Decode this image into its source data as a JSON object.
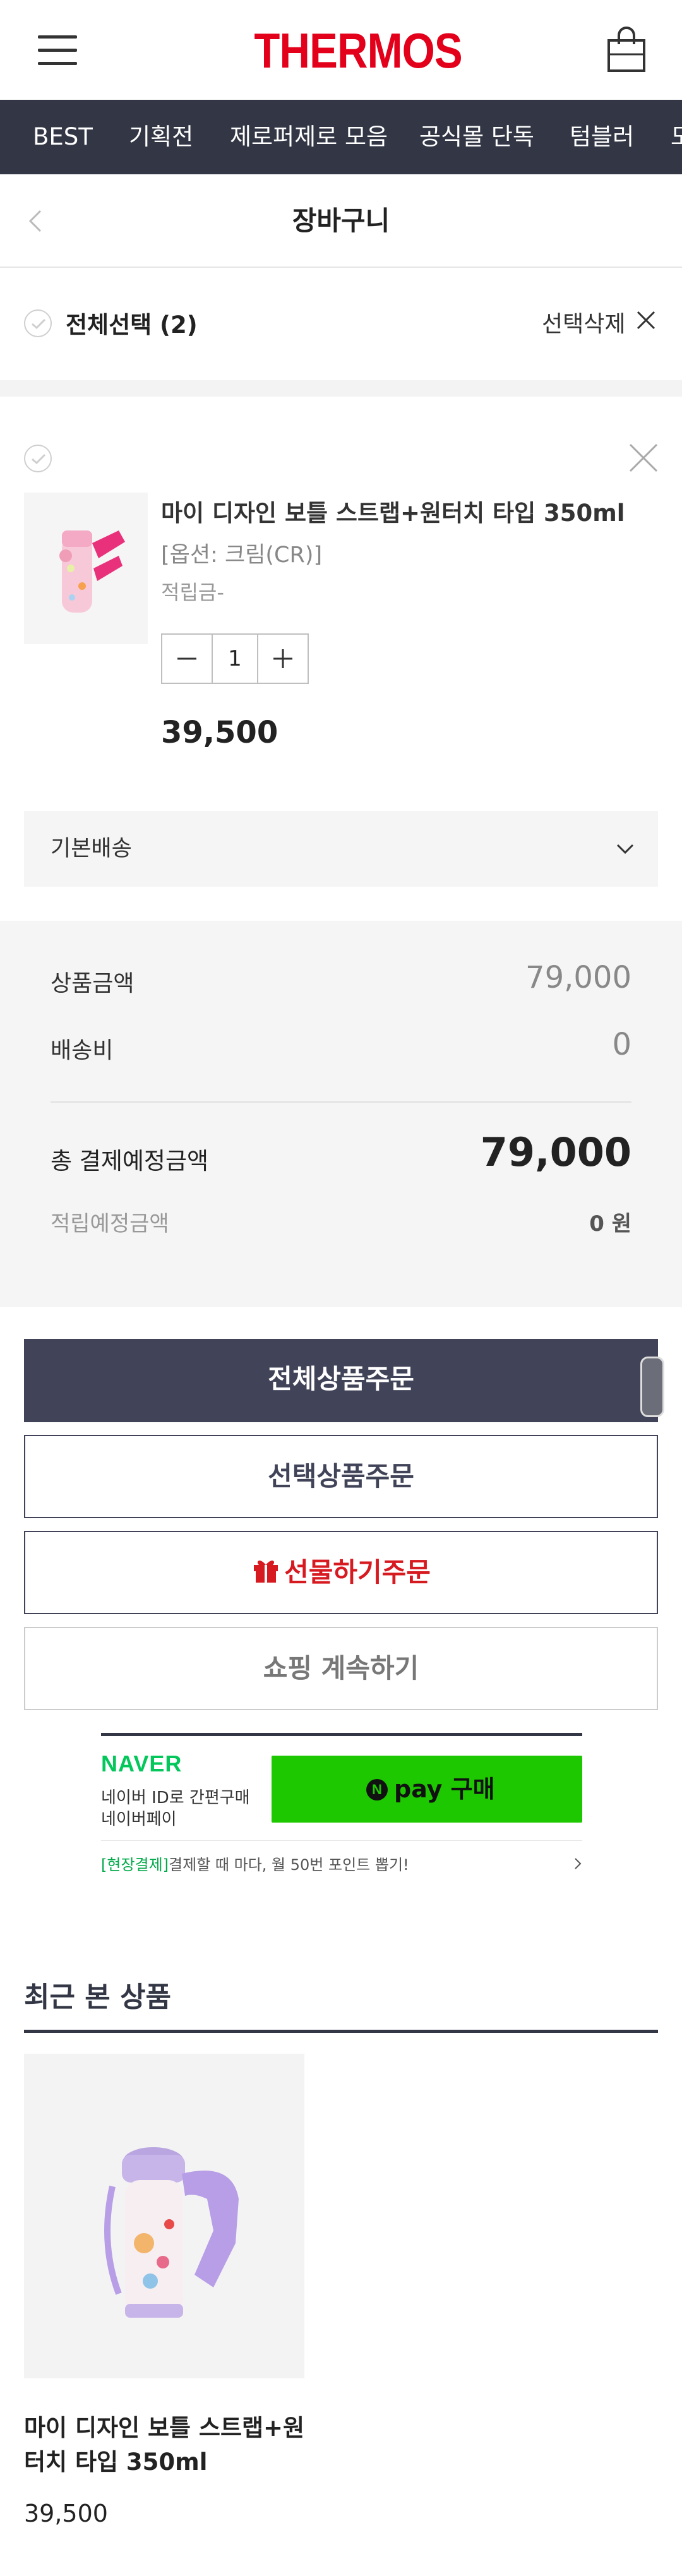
{
  "header": {
    "logo": "THERMOS",
    "menu_icon": "hamburger-icon",
    "cart_icon": "shopping-bag-icon",
    "brand_color": "#e2001a"
  },
  "category_nav": {
    "items": [
      "BEST",
      "기획전",
      "제로퍼제로 모음",
      "공식몰 단독",
      "텀블러",
      "도"
    ],
    "background": "#333745"
  },
  "page": {
    "title": "장바구니",
    "back_icon": "chevron-left-icon"
  },
  "select_all": {
    "label": "전체선택 (2)",
    "delete_label": "선택삭제"
  },
  "cart_item": {
    "name": "마이 디자인 보틀 스트랩+원터치 타입 350ml",
    "option": "[옵션: 크림(CR)]",
    "points": "적립금-",
    "quantity": "1",
    "price": "39,500"
  },
  "shipping": {
    "label": "기본배송"
  },
  "summary": {
    "product_amount_label": "상품금액",
    "product_amount": "79,000",
    "shipping_label": "배송비",
    "shipping_fee": "0",
    "total_label": "총 결제예정금액",
    "total": "79,000",
    "points_label": "적립예정금액",
    "points": "0 원"
  },
  "buttons": {
    "order_all": "전체상품주문",
    "order_selected": "선택상품주문",
    "gift_order": "선물하기주문",
    "continue_shopping": "쇼핑 계속하기",
    "gift_icon": "gift-icon"
  },
  "naver_pay": {
    "brand": "NAVER",
    "desc_line1": "네이버 ID로 간편구매",
    "desc_line2": "네이버페이",
    "pay_badge": "N",
    "pay_label": "pay 구매",
    "promo_highlight": "[현장결제]",
    "promo_text": "결제할 때 마다, 월 50번 포인트 뽑기!",
    "accent": "#1ec800"
  },
  "recent": {
    "title": "최근 본 상품",
    "items": [
      {
        "name": "마이 디자인 보틀 스트랩+원터치 타입 350ml",
        "price": "39,500"
      }
    ]
  }
}
